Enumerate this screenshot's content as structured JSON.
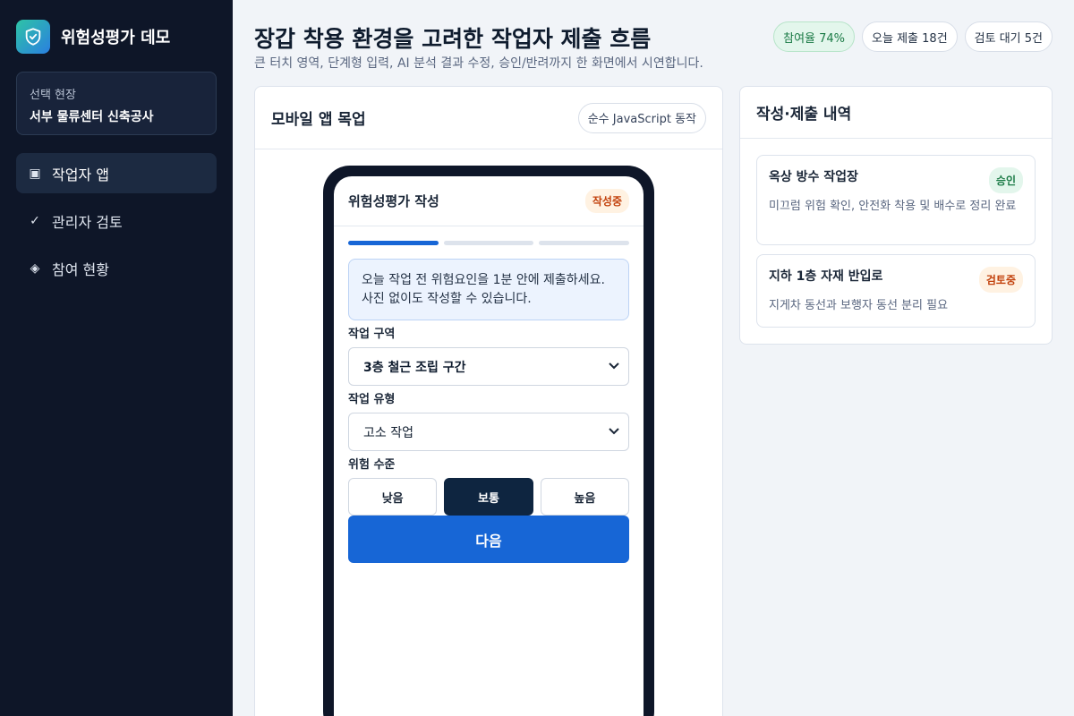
{
  "brand": {
    "title": "위험성평가 데모"
  },
  "site": {
    "label": "선택 현장",
    "name": "서부 물류센터 신축공사"
  },
  "nav": [
    {
      "icon": "▣",
      "label": "작업자 앱",
      "active": true
    },
    {
      "icon": "✓",
      "label": "관리자 검토",
      "active": false
    },
    {
      "icon": "◈",
      "label": "참여 현황",
      "active": false
    }
  ],
  "header": {
    "title": "장갑 착용 환경을 고려한 작업자 제출 흐름",
    "subtitle": "큰 터치 영역, 단계형 입력, AI 분석 결과 수정, 승인/반려까지 한 화면에서 시연합니다.",
    "badges": [
      "참여율 74%",
      "오늘 제출 18건",
      "검토 대기 5건"
    ]
  },
  "mockup": {
    "title": "모바일 앱 목업",
    "chip": "순수 JavaScript 동작",
    "screen_title": "위험성평가 작성",
    "screen_status": "작성중",
    "progress": {
      "current_step": 1,
      "total_steps": 3
    },
    "notice": "오늘 작업 전 위험요인을 1분 안에 제출하세요. 사진 없이도 작성할 수 있습니다.",
    "zone_label": "작업 구역",
    "zone_value": "3층 철근 조립 구간",
    "type_label": "작업 유형",
    "type_value": "고소 작업",
    "risk_label": "위험 수준",
    "risk_levels": [
      "낮음",
      "보통",
      "높음"
    ],
    "risk_selected": "보통",
    "next_label": "다음"
  },
  "history": {
    "title": "작성·제출 내역",
    "items": [
      {
        "title": "옥상 방수 작업장",
        "status": "승인",
        "desc": "미끄럼 위험 확인, 안전화 착용 및 배수로 정리 완료"
      },
      {
        "title": "지하 1층 자재 반입로",
        "status": "검토중",
        "desc": "지게차 동선과 보행자 동선 분리 필요"
      }
    ]
  },
  "colors": {
    "accent": "#1766d6",
    "sidebar": "#0e1628",
    "approved": "#1a7a45",
    "pending": "#c2410c"
  }
}
